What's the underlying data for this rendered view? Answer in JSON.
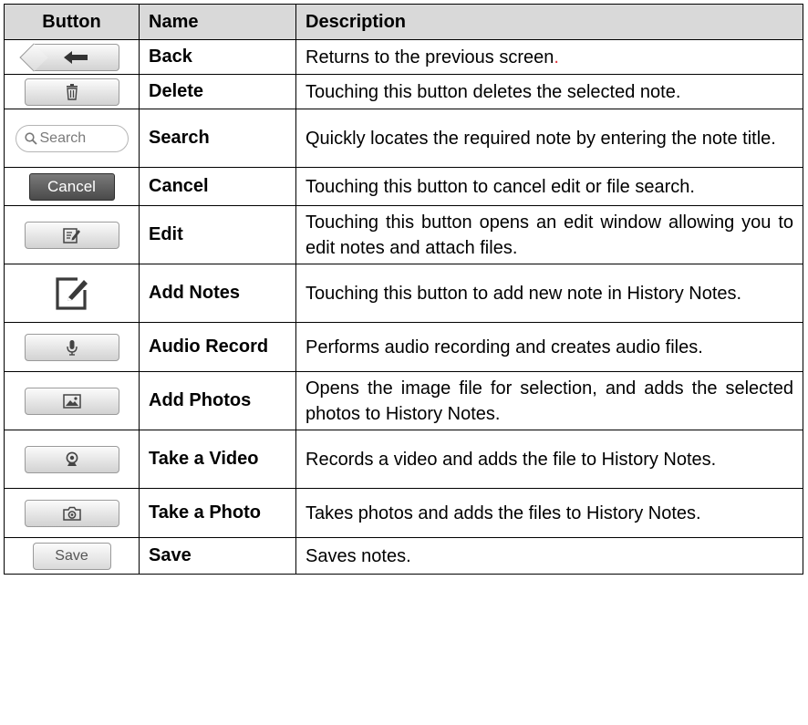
{
  "table": {
    "headers": {
      "button": "Button",
      "name": "Name",
      "description": "Description"
    },
    "rows": [
      {
        "icon": "back-arrow-icon",
        "name": "Back",
        "description": "Returns to the previous screen",
        "trail": "."
      },
      {
        "icon": "trash-icon",
        "name": "Delete",
        "description": "Touching this button deletes the selected note."
      },
      {
        "icon": "search-icon",
        "search_label": "Search",
        "name": "Search",
        "description": "Quickly locates the required note by entering the note title."
      },
      {
        "cancel_label": "Cancel",
        "name": "Cancel",
        "description": "Touching this button to cancel edit or file search."
      },
      {
        "icon": "edit-icon",
        "name": "Edit",
        "description": "Touching this button opens an edit window allowing you to edit notes and attach files."
      },
      {
        "icon": "add-note-icon",
        "name": "Add Notes",
        "description": "Touching this button to add new note in History Notes."
      },
      {
        "icon": "microphone-icon",
        "name": "Audio Record",
        "description": "Performs audio recording and creates audio files."
      },
      {
        "icon": "image-icon",
        "name": "Add Photos",
        "description": "Opens the image file for selection, and adds the selected photos to History Notes."
      },
      {
        "icon": "webcam-icon",
        "name": "Take a Video",
        "description": "Records a video and adds the file to History Notes."
      },
      {
        "icon": "camera-icon",
        "name": "Take a Photo",
        "description": "Takes photos and adds the files to History Notes."
      },
      {
        "save_label": "Save",
        "name": "Save",
        "description": "Saves notes."
      }
    ]
  },
  "colors": {
    "header_bg": "#d9d9d9",
    "accent_red": "#e0393e",
    "cancel_bg": "#5a5a5a"
  }
}
